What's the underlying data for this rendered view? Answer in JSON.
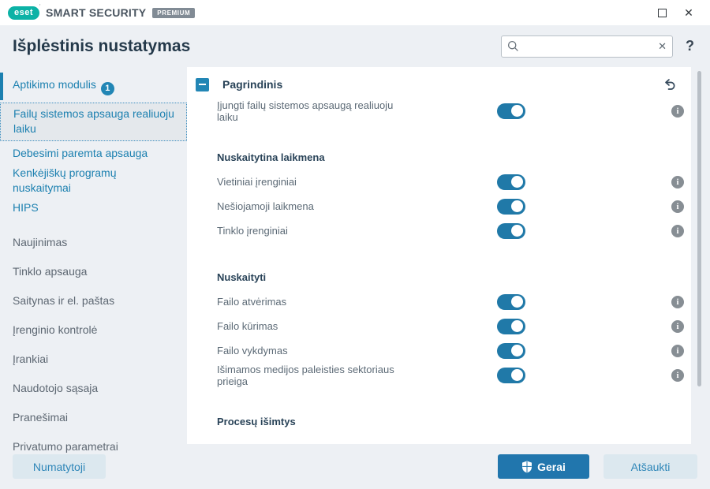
{
  "titlebar": {
    "logo_text": "eset",
    "product_name": "SMART SECURITY",
    "edition_badge": "PREMIUM",
    "maximize_glyph": "",
    "close_glyph": "✕"
  },
  "header": {
    "title": "Išplėstinis nustatymas",
    "search_value": "",
    "search_placeholder": "",
    "clear_glyph": "✕",
    "help_glyph": "?"
  },
  "sidebar": {
    "items": [
      {
        "label": "Aptikimo modulis",
        "badge": "1",
        "style": "parent-active"
      },
      {
        "label": "Failų sistemos apsauga realiuoju laiku",
        "badge": "",
        "style": "selected"
      },
      {
        "label": "Debesimi paremta apsauga",
        "badge": "",
        "style": "sub"
      },
      {
        "label": "Kenkėjiškų programų nuskaitymai",
        "badge": "",
        "style": "sub"
      },
      {
        "label": "HIPS",
        "badge": "",
        "style": "sub"
      },
      {
        "label": "Naujinimas",
        "badge": "",
        "style": "top"
      },
      {
        "label": "Tinklo apsauga",
        "badge": "",
        "style": "top"
      },
      {
        "label": "Saitynas ir el. paštas",
        "badge": "",
        "style": "top"
      },
      {
        "label": "Įrenginio kontrolė",
        "badge": "",
        "style": "top"
      },
      {
        "label": "Įrankiai",
        "badge": "",
        "style": "top"
      },
      {
        "label": "Naudotojo sąsaja",
        "badge": "",
        "style": "top"
      },
      {
        "label": "Pranešimai",
        "badge": "",
        "style": "top"
      },
      {
        "label": "Privatumo parametrai",
        "badge": "",
        "style": "top"
      }
    ]
  },
  "content": {
    "section": {
      "title": "Pagrindinis",
      "collapsed": false
    },
    "groups": [
      {
        "heading": "",
        "rows": [
          {
            "label": "Įjungti failų sistemos apsaugą realiuoju laiku",
            "toggle": "on",
            "info": true
          }
        ]
      },
      {
        "heading": "Nuskaitytina laikmena",
        "rows": [
          {
            "label": "Vietiniai įrenginiai",
            "toggle": "on",
            "info": true
          },
          {
            "label": "Nešiojamoji laikmena",
            "toggle": "on",
            "info": true
          },
          {
            "label": "Tinklo įrenginiai",
            "toggle": "on",
            "info": true
          }
        ]
      },
      {
        "heading": "Nuskaityti",
        "rows": [
          {
            "label": "Failo atvėrimas",
            "toggle": "on",
            "info": true
          },
          {
            "label": "Failo kūrimas",
            "toggle": "on",
            "info": true
          },
          {
            "label": "Failo vykdymas",
            "toggle": "on",
            "info": true
          },
          {
            "label": "Išimamos medijos paleisties sektoriaus prieiga",
            "toggle": "on",
            "info": true
          }
        ]
      },
      {
        "heading": "Procesų išimtys",
        "rows": []
      }
    ]
  },
  "footer": {
    "default_button": "Numatytoji",
    "ok_button": "Gerai",
    "cancel_button": "Atšaukti"
  },
  "colors": {
    "accent_blue": "#2286b5",
    "toggle_on": "#2079a8",
    "heading_navy": "#294358",
    "ok_button_bg": "#2176ad",
    "logo_teal": "#0cb2a6"
  }
}
